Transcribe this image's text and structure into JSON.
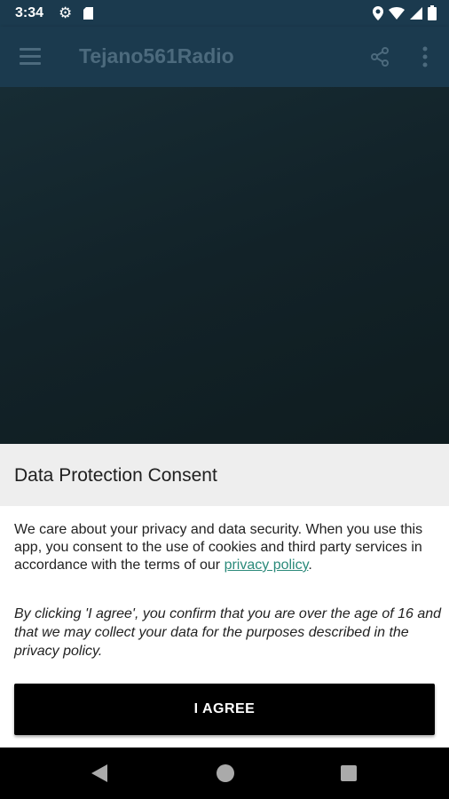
{
  "status_bar": {
    "time": "3:34"
  },
  "app_bar": {
    "title": "Tejano561Radio"
  },
  "dialog": {
    "title": "Data Protection Consent",
    "body_text": "We care about your privacy and data security. When you use this app, you consent to the use of cookies and third party services in accordance with the terms of our ",
    "privacy_link": "privacy policy",
    "body_end": ".",
    "note": "By clicking 'I agree', you confirm that you are over the age of 16 and that we may collect your data for the purposes described in the privacy policy.",
    "agree_label": "I AGREE"
  },
  "colors": {
    "app_bar": "#1b3a4e",
    "title_text": "#4c6a7d",
    "link": "#2b8a7a",
    "button": "#000000"
  },
  "icons": [
    "gear-icon",
    "sd-card-icon",
    "location-icon",
    "wifi-icon",
    "signal-icon",
    "battery-icon",
    "menu-icon",
    "share-icon",
    "more-vert-icon",
    "back-icon",
    "home-icon",
    "recents-icon"
  ]
}
